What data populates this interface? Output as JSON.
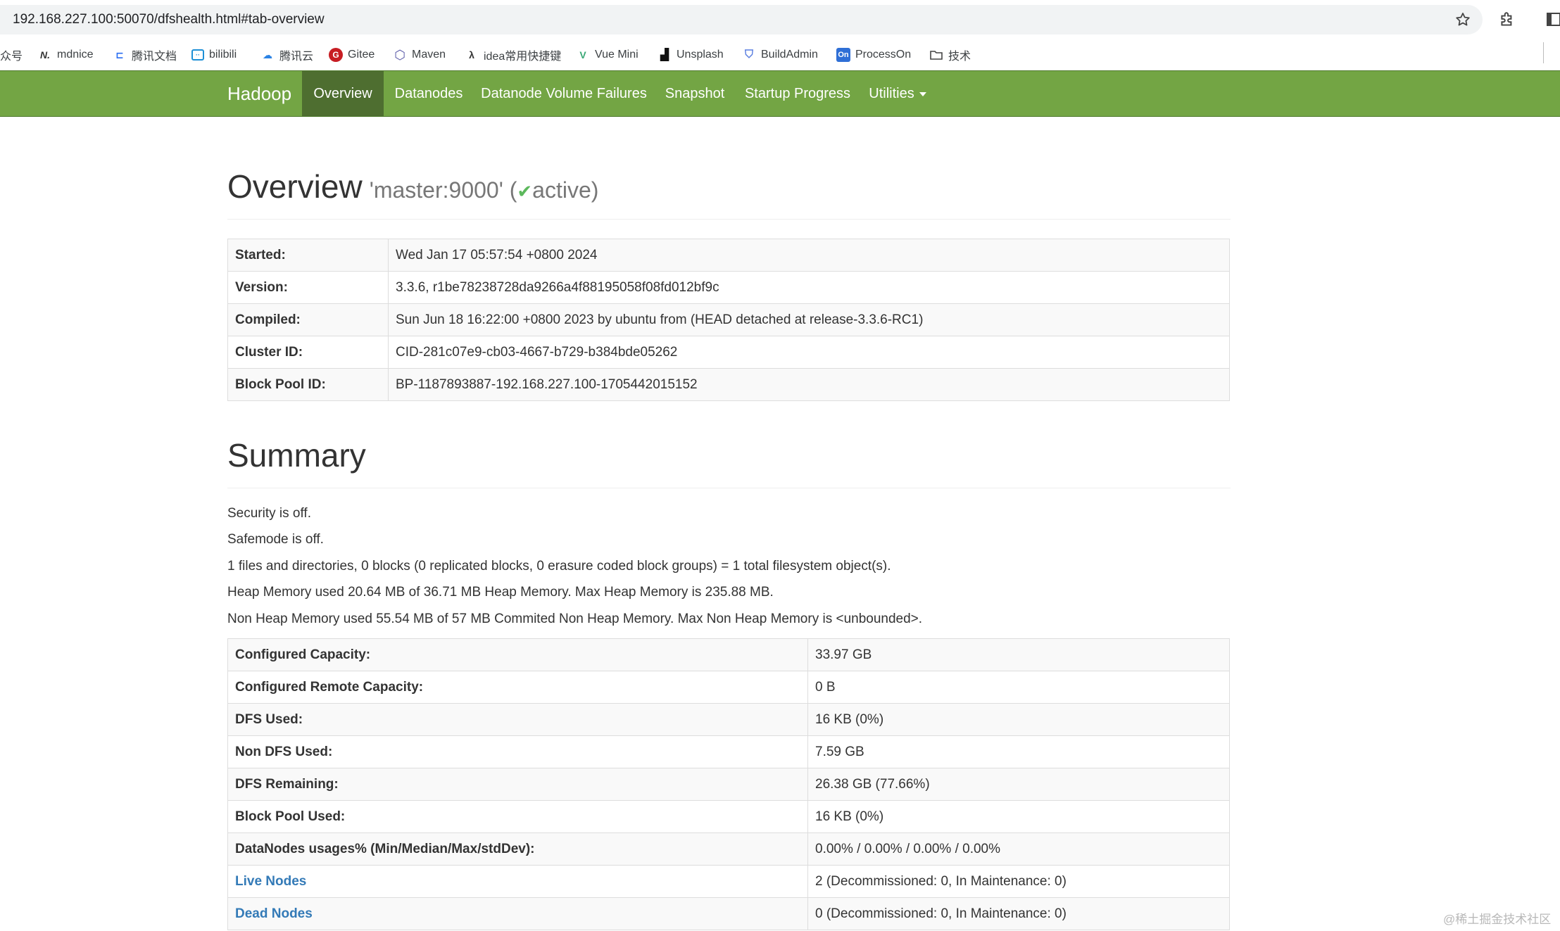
{
  "browser": {
    "url": "192.168.227.100:50070/dfshealth.html#tab-overview",
    "bookmarks": [
      {
        "label": "众号",
        "icon": "none"
      },
      {
        "label": "mdnice",
        "icon": "mdnice-icon"
      },
      {
        "label": "腾讯文档",
        "icon": "tencent-docs-icon"
      },
      {
        "label": "bilibili",
        "icon": "bilibili-icon"
      },
      {
        "label": "腾讯云",
        "icon": "tencent-cloud-icon"
      },
      {
        "label": "Gitee",
        "icon": "gitee-icon"
      },
      {
        "label": "Maven",
        "icon": "maven-icon"
      },
      {
        "label": "idea常用快捷键",
        "icon": "idea-icon"
      },
      {
        "label": "Vue Mini",
        "icon": "vue-icon"
      },
      {
        "label": "Unsplash",
        "icon": "unsplash-icon"
      },
      {
        "label": "BuildAdmin",
        "icon": "buildadmin-icon"
      },
      {
        "label": "ProcessOn",
        "icon": "processon-icon"
      },
      {
        "label": "技术",
        "icon": "folder-icon"
      }
    ]
  },
  "navbar": {
    "brand": "Hadoop",
    "items": [
      "Overview",
      "Datanodes",
      "Datanode Volume Failures",
      "Snapshot",
      "Startup Progress",
      "Utilities"
    ],
    "active": "Overview",
    "color": "#73a544"
  },
  "overview": {
    "title": "Overview",
    "host": "'master:9000'",
    "status_open": "(",
    "check": "✔",
    "status": "active)",
    "rows": [
      {
        "key": "Started:",
        "value": "Wed Jan 17 05:57:54 +0800 2024"
      },
      {
        "key": "Version:",
        "value": "3.3.6, r1be78238728da9266a4f88195058f08fd012bf9c"
      },
      {
        "key": "Compiled:",
        "value": "Sun Jun 18 16:22:00 +0800 2023 by ubuntu from (HEAD detached at release-3.3.6-RC1)"
      },
      {
        "key": "Cluster ID:",
        "value": "CID-281c07e9-cb03-4667-b729-b384bde05262"
      },
      {
        "key": "Block Pool ID:",
        "value": "BP-1187893887-192.168.227.100-1705442015152"
      }
    ]
  },
  "summary": {
    "title": "Summary",
    "lines": [
      "Security is off.",
      "Safemode is off.",
      "1 files and directories, 0 blocks (0 replicated blocks, 0 erasure coded block groups) = 1 total filesystem object(s).",
      "Heap Memory used 20.64 MB of 36.71 MB Heap Memory. Max Heap Memory is 235.88 MB.",
      "Non Heap Memory used 55.54 MB of 57 MB Commited Non Heap Memory. Max Non Heap Memory is <unbounded>."
    ],
    "rows": [
      {
        "key": "Configured Capacity:",
        "value": "33.97 GB"
      },
      {
        "key": "Configured Remote Capacity:",
        "value": "0 B"
      },
      {
        "key": "DFS Used:",
        "value": "16 KB (0%)"
      },
      {
        "key": "Non DFS Used:",
        "value": "7.59 GB"
      },
      {
        "key": "DFS Remaining:",
        "value": "26.38 GB (77.66%)"
      },
      {
        "key": "Block Pool Used:",
        "value": "16 KB (0%)"
      },
      {
        "key": "DataNodes usages% (Min/Median/Max/stdDev):",
        "value": "0.00% / 0.00% / 0.00% / 0.00%"
      },
      {
        "key": "Live Nodes",
        "value": "2 (Decommissioned: 0, In Maintenance: 0)"
      },
      {
        "key": "Dead Nodes",
        "value": "0 (Decommissioned: 0, In Maintenance: 0)"
      }
    ]
  },
  "watermark": "@稀土掘金技术社区"
}
